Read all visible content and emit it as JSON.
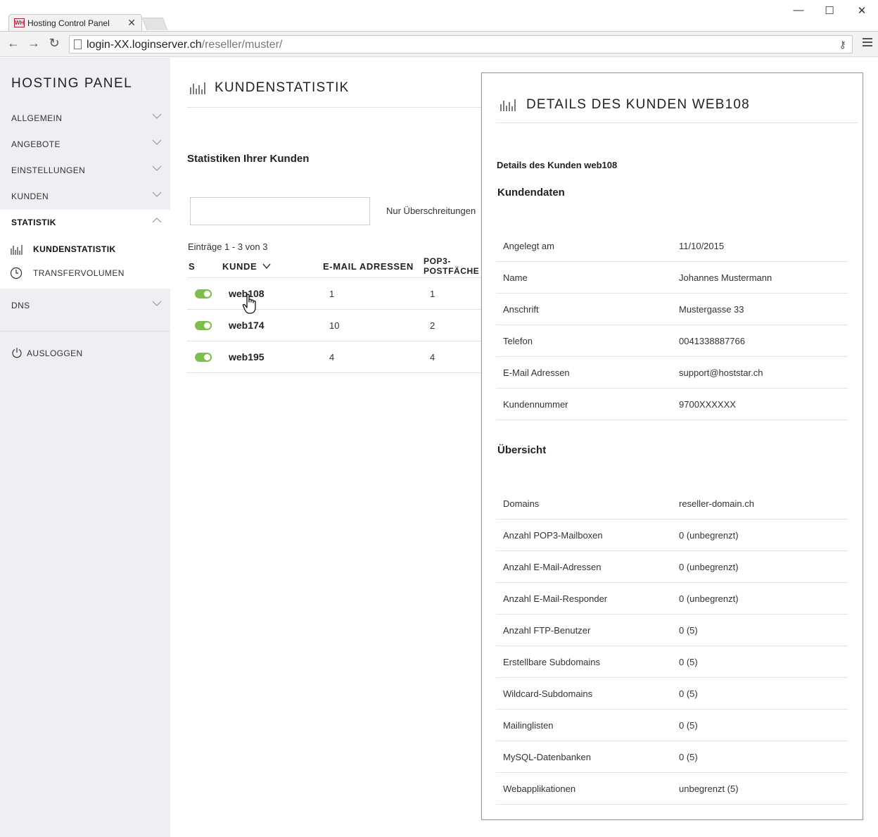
{
  "browser": {
    "tab_title": "Hosting Control Panel",
    "favicon_text": "WH",
    "url_host": "login-XX.loginserver.ch",
    "url_path": "/reseller/muster/"
  },
  "sidebar": {
    "brand": "HOSTING PANEL",
    "items": [
      {
        "label": "ALLGEMEIN"
      },
      {
        "label": "ANGEBOTE"
      },
      {
        "label": "EINSTELLUNGEN"
      },
      {
        "label": "KUNDEN"
      },
      {
        "label": "STATISTIK"
      },
      {
        "label": "DNS"
      }
    ],
    "sub_items": [
      {
        "label": "KUNDENSTATISTIK"
      },
      {
        "label": "TRANSFERVOLUMEN"
      }
    ],
    "logout": "AUSLOGGEN"
  },
  "main": {
    "page_title": "KUNDENSTATISTIK",
    "section_title": "Statistiken Ihrer Kunden",
    "search_placeholder": "",
    "filter_label": "Nur Überschreitungen",
    "entries": "Einträge 1 - 3 von 3",
    "columns": {
      "status": "S",
      "kunde": "KUNDE",
      "email": "E-MAIL ADRESSEN",
      "pop3_line1": "POP3-",
      "pop3_line2": "POSTFÄCHE"
    },
    "rows": [
      {
        "kunde": "web108",
        "email": "1",
        "pop3": "1"
      },
      {
        "kunde": "web174",
        "email": "10",
        "pop3": "2"
      },
      {
        "kunde": "web195",
        "email": "4",
        "pop3": "4"
      }
    ]
  },
  "panel": {
    "title": "DETAILS DES KUNDEN WEB108",
    "subheading": "Details des Kunden web108",
    "kundendaten_title": "Kundendaten",
    "kundendaten": [
      {
        "key": "Angelegt am",
        "value": "11/10/2015"
      },
      {
        "key": "Name",
        "value": "Johannes Mustermann"
      },
      {
        "key": "Anschrift",
        "value": "Mustergasse 33"
      },
      {
        "key": "Telefon",
        "value": "0041338887766"
      },
      {
        "key": "E-Mail Adressen",
        "value": "support@hoststar.ch"
      },
      {
        "key": "Kundennummer",
        "value": "9700XXXXXX"
      }
    ],
    "uebersicht_title": "Übersicht",
    "uebersicht": [
      {
        "key": "Domains",
        "value": "reseller-domain.ch"
      },
      {
        "key": "Anzahl POP3-Mailboxen",
        "value": "0 (unbegrenzt)"
      },
      {
        "key": "Anzahl E-Mail-Adressen",
        "value": "0 (unbegrenzt)"
      },
      {
        "key": "Anzahl E-Mail-Responder",
        "value": "0 (unbegrenzt)"
      },
      {
        "key": "Anzahl FTP-Benutzer",
        "value": "0 (5)"
      },
      {
        "key": "Erstellbare Subdomains",
        "value": "0 (5)"
      },
      {
        "key": "Wildcard-Subdomains",
        "value": "0 (5)"
      },
      {
        "key": "Mailinglisten",
        "value": "0 (5)"
      },
      {
        "key": "MySQL-Datenbanken",
        "value": "0 (5)"
      },
      {
        "key": "Webapplikationen",
        "value": "unbegrenzt (5)"
      }
    ]
  },
  "colors": {
    "sidebar_bg": "#eeeef3",
    "toggle_on": "#7cc04b"
  }
}
